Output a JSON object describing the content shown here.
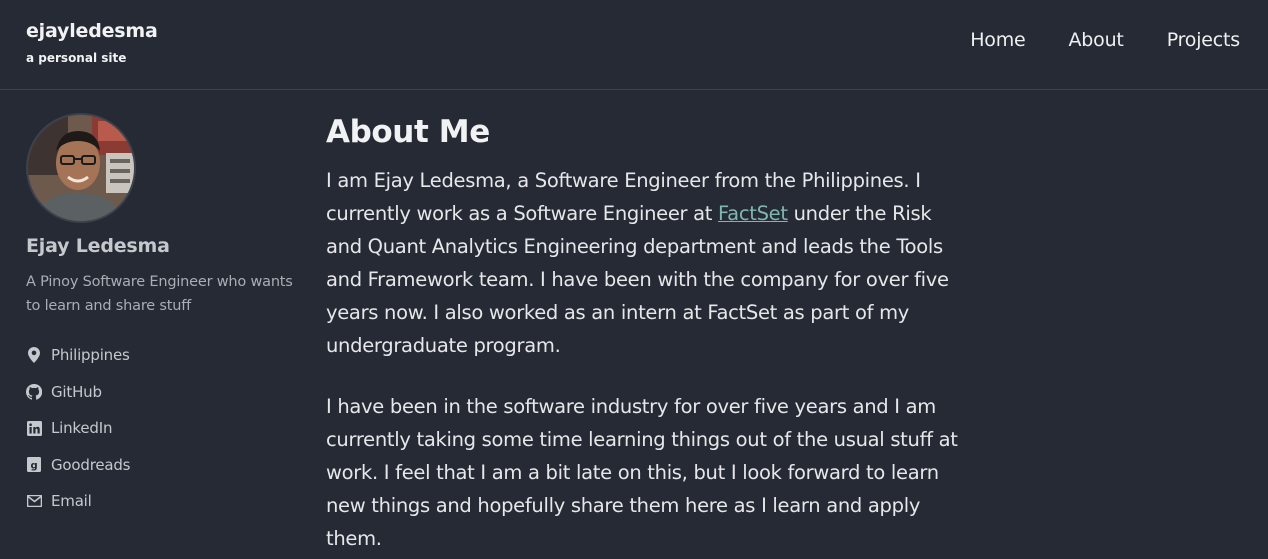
{
  "header": {
    "site_title": "ejayledesma",
    "site_subtitle": "a personal site",
    "nav": [
      {
        "label": "Home"
      },
      {
        "label": "About"
      },
      {
        "label": "Projects"
      }
    ]
  },
  "sidebar": {
    "author_name": "Ejay Ledesma",
    "author_bio": "A Pinoy Software Engineer who wants to learn and share stuff",
    "links": [
      {
        "label": "Philippines",
        "icon": "map-marker-icon"
      },
      {
        "label": "GitHub",
        "icon": "github-icon"
      },
      {
        "label": "LinkedIn",
        "icon": "linkedin-icon"
      },
      {
        "label": "Goodreads",
        "icon": "goodreads-icon"
      },
      {
        "label": "Email",
        "icon": "email-icon"
      }
    ]
  },
  "main": {
    "title": "About Me",
    "p1_before": "I am Ejay Ledesma, a Software Engineer from the Philippines. I currently work as a Software Engineer at ",
    "p1_link": "FactSet",
    "p1_after": " under the Risk and Quant Analytics Engineering department and leads the Tools and Framework team. I have been with the company for over five years now. I also worked as an intern at FactSet as part of my undergraduate program.",
    "p2": "I have been in the software industry for over five years and I am currently taking some time learning things out of the usual stuff at work. I feel that I am a bit late on this, but I look forward to learn new things and hopefully share them here as I learn and apply them."
  },
  "colors": {
    "background": "#252a34",
    "link": "#7fb6b0",
    "text": "#e6e7ea",
    "muted": "#a9adb4"
  }
}
